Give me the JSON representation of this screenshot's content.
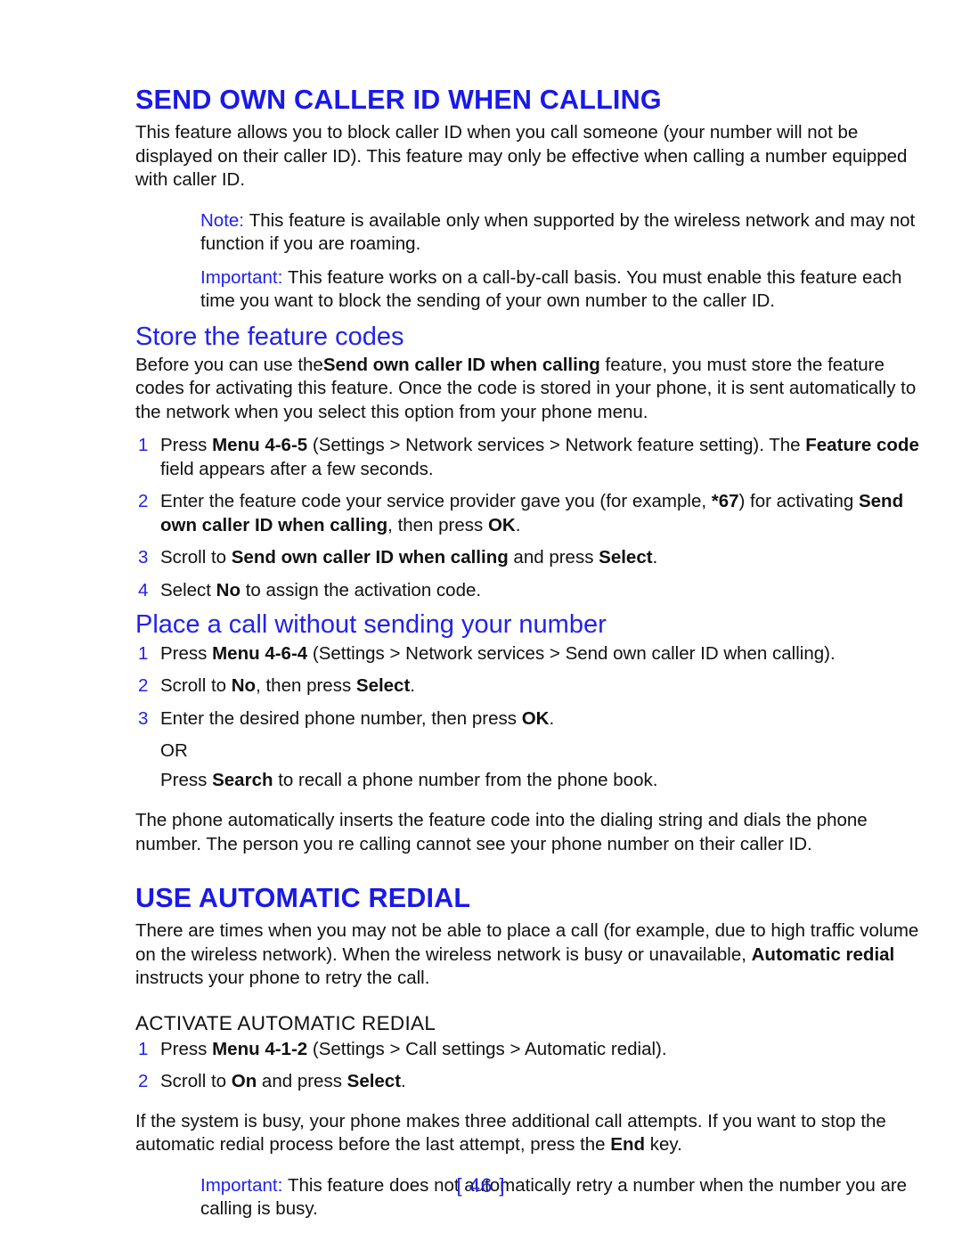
{
  "page": {
    "footer_label": "[ 46 ]",
    "accent_blue": "#2222EE",
    "heading_blue": "#1919E8",
    "body_color": "#111111"
  },
  "section1": {
    "title": "SEND OWN CALLER ID WHEN CALLING",
    "intro": "This feature allows you to block caller ID when you call someone (your number will not be displayed on their caller ID). This feature may only be effective when calling a number equipped with caller ID.",
    "note_label": "Note:",
    "note_text": "This feature is available only when supported by the wireless network and may not function if you are roaming.",
    "important_label": "Important:",
    "important_text": "This feature works on a call-by-call basis. You must enable this feature each time you want to block the sending of your own number to the caller ID."
  },
  "store_codes": {
    "title": "Store the feature codes",
    "intro_a": "Before you can use the",
    "intro_bold": "Send own caller ID when calling",
    "intro_b": "feature, you must store the feature codes for activating this feature. Once the code is stored in your phone, it is sent automatically to the network when you select this option from your phone menu.",
    "steps": [
      {
        "num": "1",
        "parts": [
          {
            "t": "Press ",
            "b": false
          },
          {
            "t": "Menu 4-6-5",
            "b": true
          },
          {
            "t": " (Settings > Network services > Network feature setting",
            "b": false
          },
          {
            "t": ")",
            "b": false
          },
          {
            "t": ". The ",
            "b": false
          },
          {
            "t": "Feature code",
            "b": true
          },
          {
            "t": " field appears after a few seconds.",
            "b": false
          }
        ]
      },
      {
        "num": "2",
        "parts": [
          {
            "t": "Enter the feature code your service provider gave you (for example, ",
            "b": false
          },
          {
            "t": "*67",
            "b": true
          },
          {
            "t": ") for activating ",
            "b": false
          },
          {
            "t": "Send own caller ID when calling",
            "b": true
          },
          {
            "t": ", then press ",
            "b": false
          },
          {
            "t": "OK",
            "b": true
          },
          {
            "t": ".",
            "b": false
          }
        ]
      },
      {
        "num": "3",
        "parts": [
          {
            "t": "Scroll to ",
            "b": false
          },
          {
            "t": "Send own caller ID when calling",
            "b": true
          },
          {
            "t": " and press ",
            "b": false
          },
          {
            "t": "Select",
            "b": true
          },
          {
            "t": ".",
            "b": false
          }
        ]
      },
      {
        "num": "4",
        "parts": [
          {
            "t": "Select ",
            "b": false
          },
          {
            "t": "No",
            "b": true
          },
          {
            "t": " to assign the activation code.",
            "b": false
          }
        ]
      }
    ]
  },
  "place_call": {
    "title": "Place a call without sending your number",
    "steps": [
      {
        "num": "1",
        "parts": [
          {
            "t": "Press ",
            "b": false
          },
          {
            "t": "Menu 4-6-4",
            "b": true
          },
          {
            "t": " (Settings > Network services > Send own caller ID when calling",
            "b": false
          },
          {
            "t": ").",
            "b": false
          }
        ]
      },
      {
        "num": "2",
        "parts": [
          {
            "t": "Scroll to ",
            "b": false
          },
          {
            "t": "No",
            "b": true
          },
          {
            "t": ", then press ",
            "b": false
          },
          {
            "t": "Select",
            "b": true
          },
          {
            "t": ".",
            "b": false
          }
        ]
      },
      {
        "num": "3",
        "parts": [
          {
            "t": "Enter the desired phone number, then press ",
            "b": false
          },
          {
            "t": "OK",
            "b": true
          },
          {
            "t": ".",
            "b": false
          }
        ]
      }
    ],
    "or_label": "OR",
    "or_a": "Press ",
    "or_bold": "Search",
    "or_b": " to recall a phone number from the phone book.",
    "closing": "The phone automatically inserts the feature code into the dialing string and dials the phone number. The person you re calling cannot see your phone number on their caller ID."
  },
  "auto_redial": {
    "title": "USE AUTOMATIC REDIAL",
    "intro_a": "There are times when you may not be able to place a call (for example, due to high traffic volume on the wireless network). When the wireless network is busy or unavailable, ",
    "intro_bold": "Automatic redial",
    "intro_b": " instructs your phone to retry the call.",
    "activate_title": "ACTIVATE AUTOMATIC REDIAL",
    "steps": [
      {
        "num": "1",
        "parts": [
          {
            "t": "Press ",
            "b": false
          },
          {
            "t": "Menu 4-1-2",
            "b": true
          },
          {
            "t": " (Settings > Call settings > Automatic redial",
            "b": false
          },
          {
            "t": ").",
            "b": false
          }
        ]
      },
      {
        "num": "2",
        "parts": [
          {
            "t": "Scroll to ",
            "b": false
          },
          {
            "t": "On",
            "b": true
          },
          {
            "t": " and press ",
            "b": false
          },
          {
            "t": "Select",
            "b": true
          },
          {
            "t": ".",
            "b": false
          }
        ]
      }
    ],
    "closing_a": "If the system is busy, your phone makes three additional call attempts. If you want to stop the automatic redial process before the last attempt, press the ",
    "closing_bold": "End",
    "closing_b": " key.",
    "important_label": "Important:",
    "important_text": "This feature does not automatically retry a number when the number you are calling is busy."
  }
}
